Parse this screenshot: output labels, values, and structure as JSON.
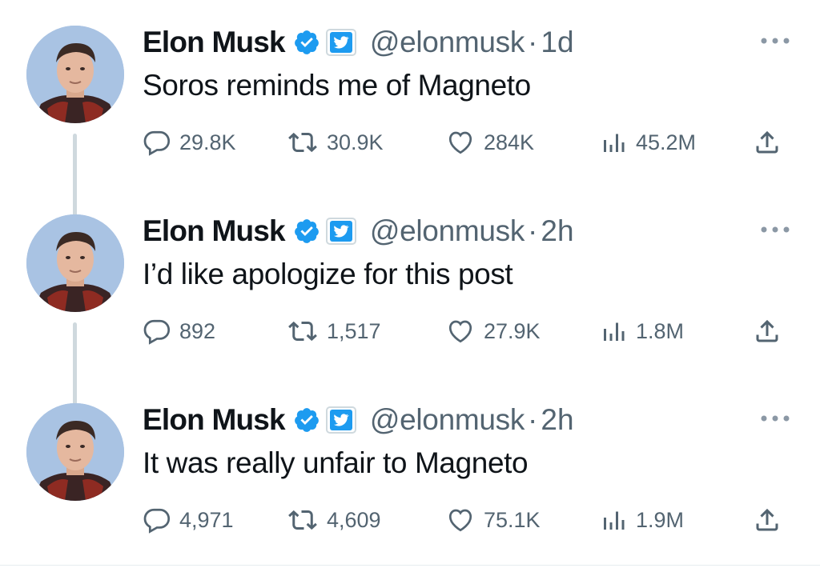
{
  "tweets": [
    {
      "author_name": "Elon Musk",
      "handle": "@elonmusk",
      "separator": "·",
      "time": "1d",
      "text": "Soros reminds me of Magneto",
      "stats": {
        "replies": "29.8K",
        "retweets": "30.9K",
        "likes": "284K",
        "views": "45.2M"
      }
    },
    {
      "author_name": "Elon Musk",
      "handle": "@elonmusk",
      "separator": "·",
      "time": "2h",
      "text": "I’d like apologize for this post",
      "stats": {
        "replies": "892",
        "retweets": "1,517",
        "likes": "27.9K",
        "views": "1.8M"
      }
    },
    {
      "author_name": "Elon Musk",
      "handle": "@elonmusk",
      "separator": "·",
      "time": "2h",
      "text": "It was really unfair to Magneto",
      "stats": {
        "replies": "4,971",
        "retweets": "4,609",
        "likes": "75.1K",
        "views": "1.9M"
      }
    }
  ],
  "icons": {
    "verified": "verified-badge-icon",
    "affiliate": "twitter-bird-badge-icon",
    "more": "more-options-icon",
    "reply": "reply-icon",
    "retweet": "retweet-icon",
    "like": "heart-icon",
    "views": "views-chart-icon",
    "share": "share-icon"
  },
  "colors": {
    "verified_blue": "#1d9bf0",
    "text": "#0f1419",
    "secondary": "#536471",
    "thread_line": "#cfd9de"
  }
}
